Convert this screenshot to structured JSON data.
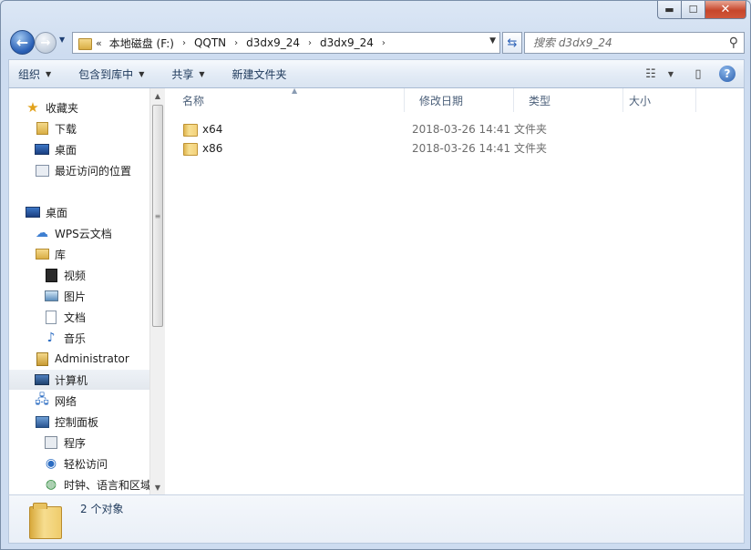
{
  "window": {
    "min_glyph": "▬",
    "max_glyph": "☐",
    "close_glyph": "✕"
  },
  "address": {
    "overflow": "«",
    "crumbs": [
      "本地磁盘 (F:)",
      "QQTN",
      "d3dx9_24",
      "d3dx9_24"
    ],
    "separator": "›"
  },
  "search": {
    "placeholder": "搜索 d3dx9_24"
  },
  "toolbar": {
    "organize": "组织",
    "include_in_library": "包含到库中",
    "share": "共享",
    "new_folder": "新建文件夹"
  },
  "nav": {
    "favorites": "收藏夹",
    "downloads": "下载",
    "desktop_fav": "桌面",
    "recent": "最近访问的位置",
    "desktop": "桌面",
    "wps": "WPS云文档",
    "libraries": "库",
    "videos": "视频",
    "pictures": "图片",
    "documents": "文档",
    "music": "音乐",
    "admin": "Administrator",
    "computer": "计算机",
    "network": "网络",
    "control_panel": "控制面板",
    "programs": "程序",
    "ease_access": "轻松访问",
    "clock_region": "时钟、语言和区域"
  },
  "columns": {
    "name": "名称",
    "date": "修改日期",
    "type": "类型",
    "size": "大小"
  },
  "files": [
    {
      "name": "x64",
      "date": "2018-03-26 14:41",
      "type": "文件夹"
    },
    {
      "name": "x86",
      "date": "2018-03-26 14:41",
      "type": "文件夹"
    }
  ],
  "details": {
    "count": "2 个对象"
  }
}
